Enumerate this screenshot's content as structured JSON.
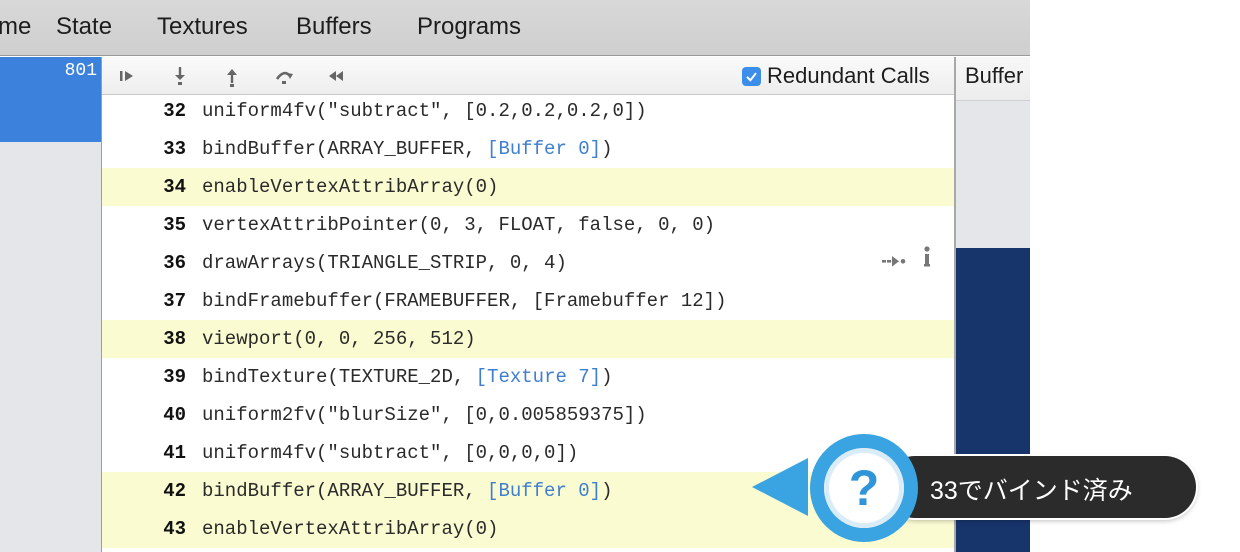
{
  "tabs": [
    "me",
    "State",
    "Textures",
    "Buffers",
    "Programs"
  ],
  "frame": {
    "number": "801"
  },
  "toolbar": {
    "buttons": [
      "play-icon",
      "step-down-icon",
      "step-up-icon",
      "step-over-icon",
      "rewind-icon"
    ],
    "redundant_calls": {
      "label": "Redundant Calls",
      "checked": true
    }
  },
  "calls": [
    {
      "line": "32",
      "text": "uniform4fv(\"subtract\", [0.2,0.2,0.2,0])",
      "highlighted": false
    },
    {
      "line": "33",
      "pre": "bindBuffer(ARRAY_BUFFER, ",
      "link": "[Buffer 0]",
      "post": ")",
      "highlighted": false
    },
    {
      "line": "34",
      "text": "enableVertexAttribArray(0)",
      "highlighted": true
    },
    {
      "line": "35",
      "text": "vertexAttribPointer(0, 3, FLOAT, false, 0, 0)",
      "highlighted": false
    },
    {
      "line": "36",
      "text": "drawArrays(TRIANGLE_STRIP, 0, 4)",
      "highlighted": false,
      "icons": [
        "goto-icon",
        "info-icon"
      ]
    },
    {
      "line": "37",
      "text": "bindFramebuffer(FRAMEBUFFER, [Framebuffer 12])",
      "highlighted": false
    },
    {
      "line": "38",
      "text": "viewport(0, 0, 256, 512)",
      "highlighted": true
    },
    {
      "line": "39",
      "pre": "bindTexture(TEXTURE_2D, ",
      "link": "[Texture 7]",
      "post": ")",
      "highlighted": false
    },
    {
      "line": "40",
      "text": "uniform2fv(\"blurSize\", [0,0.005859375])",
      "highlighted": false
    },
    {
      "line": "41",
      "text": "uniform4fv(\"subtract\", [0,0,0,0])",
      "highlighted": false
    },
    {
      "line": "42",
      "pre": "bindBuffer(ARRAY_BUFFER, ",
      "link": "[Buffer 0]",
      "post": ")",
      "highlighted": true
    },
    {
      "line": "43",
      "text": "enableVertexAttribArray(0)",
      "highlighted": true
    }
  ],
  "right_panel": {
    "title": "Buffer"
  },
  "tooltip": {
    "symbol": "?",
    "text": "33でバインド済み"
  },
  "colors": {
    "selection": "#3c82dc",
    "row_highlight": "#fbfbd2",
    "link": "#3f7fcf",
    "tooltip_accent": "#3aa3e2",
    "tooltip_label_bg": "#2b2b2b",
    "panel_dark": "#17346b"
  }
}
